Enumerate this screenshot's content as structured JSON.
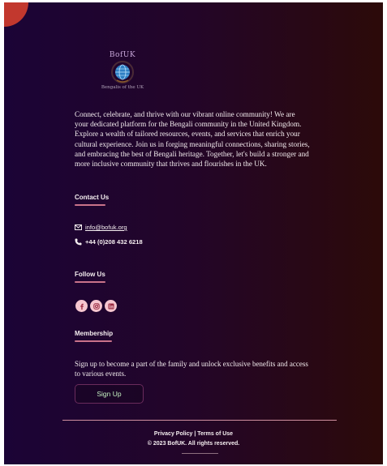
{
  "brand": {
    "logo_title": "BofUK",
    "logo_subtitle": "Bengalis of the UK"
  },
  "about": {
    "text": "Connect, celebrate, and thrive with our vibrant online community! We are your dedicated platform for the Bengali community in the United Kingdom. Explore a wealth of tailored resources, events, and services that enrich your cultural experience. Join us in forging meaningful connections, sharing stories, and embracing the best of Bengali heritage. Together, let's build a stronger and more inclusive community that thrives and flourishes in the UK."
  },
  "contact": {
    "heading": "Contact Us",
    "email": "info@bofuk.org",
    "phone": "+44 (0)208 432 6218"
  },
  "follow": {
    "heading": "Follow Us",
    "icons": [
      "facebook-icon",
      "instagram-icon",
      "linkedin-icon"
    ]
  },
  "membership": {
    "heading": "Membership",
    "text": "Sign up to become a part of the family and unlock exclusive benefits and access to various events.",
    "button_label": "Sign Up"
  },
  "footer": {
    "links": "Privacy Policy | Terms of Use",
    "copyright": "© 2023 BofUK. All rights reserved."
  },
  "colors": {
    "gradient_left": "#1b0436",
    "gradient_right": "#2c0a09",
    "accent": "#c9738a",
    "social_bg": "#f6c6cf",
    "corner": "#c2382e",
    "signup_text": "#c4f0c0"
  }
}
